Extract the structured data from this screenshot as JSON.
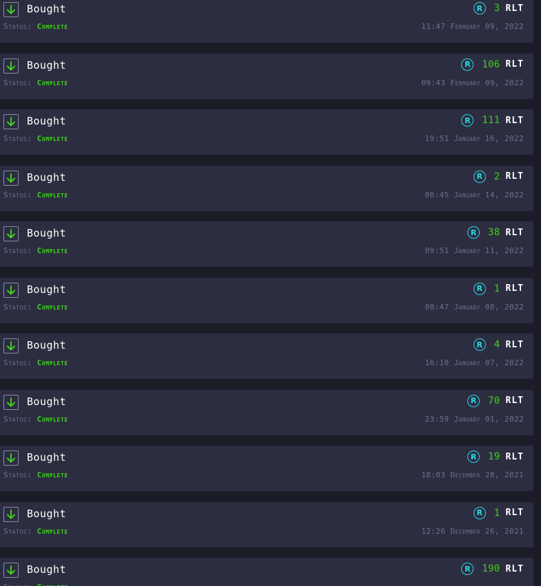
{
  "colors": {
    "background": "#1c1c28",
    "card": "#2d2d41",
    "accent_green": "#3fd11a",
    "coin_cyan": "#28d8e6",
    "muted_text": "#6f6f8d"
  },
  "transactions": [
    {
      "type": "Bought",
      "status_label": "Status:",
      "status": "Complete",
      "amount": "3",
      "currency": "RLT",
      "coin_glyph": "R",
      "icon": "download-arrow-icon",
      "datetime": "11:47 February 09, 2022"
    },
    {
      "type": "Bought",
      "status_label": "Status:",
      "status": "Complete",
      "amount": "106",
      "currency": "RLT",
      "coin_glyph": "R",
      "icon": "download-arrow-icon",
      "datetime": "09:43 February 09, 2022"
    },
    {
      "type": "Bought",
      "status_label": "Status:",
      "status": "Complete",
      "amount": "111",
      "currency": "RLT",
      "coin_glyph": "R",
      "icon": "download-arrow-icon",
      "datetime": "19:51 January 16, 2022"
    },
    {
      "type": "Bought",
      "status_label": "Status:",
      "status": "Complete",
      "amount": "2",
      "currency": "RLT",
      "coin_glyph": "R",
      "icon": "download-arrow-icon",
      "datetime": "00:45 January 14, 2022"
    },
    {
      "type": "Bought",
      "status_label": "Status:",
      "status": "Complete",
      "amount": "38",
      "currency": "RLT",
      "coin_glyph": "R",
      "icon": "download-arrow-icon",
      "datetime": "09:51 January 11, 2022"
    },
    {
      "type": "Bought",
      "status_label": "Status:",
      "status": "Complete",
      "amount": "1",
      "currency": "RLT",
      "coin_glyph": "R",
      "icon": "download-arrow-icon",
      "datetime": "08:47 January 08, 2022"
    },
    {
      "type": "Bought",
      "status_label": "Status:",
      "status": "Complete",
      "amount": "4",
      "currency": "RLT",
      "coin_glyph": "R",
      "icon": "download-arrow-icon",
      "datetime": "16:10 January 07, 2022"
    },
    {
      "type": "Bought",
      "status_label": "Status:",
      "status": "Complete",
      "amount": "70",
      "currency": "RLT",
      "coin_glyph": "R",
      "icon": "download-arrow-icon",
      "datetime": "23:59 January 01, 2022"
    },
    {
      "type": "Bought",
      "status_label": "Status:",
      "status": "Complete",
      "amount": "19",
      "currency": "RLT",
      "coin_glyph": "R",
      "icon": "download-arrow-icon",
      "datetime": "18:03 December 28, 2021"
    },
    {
      "type": "Bought",
      "status_label": "Status:",
      "status": "Complete",
      "amount": "1",
      "currency": "RLT",
      "coin_glyph": "R",
      "icon": "download-arrow-icon",
      "datetime": "12:26 December 26, 2021"
    },
    {
      "type": "Bought",
      "status_label": "Status:",
      "status": "Complete",
      "amount": "190",
      "currency": "RLT",
      "coin_glyph": "R",
      "icon": "download-arrow-icon",
      "datetime": ""
    }
  ]
}
